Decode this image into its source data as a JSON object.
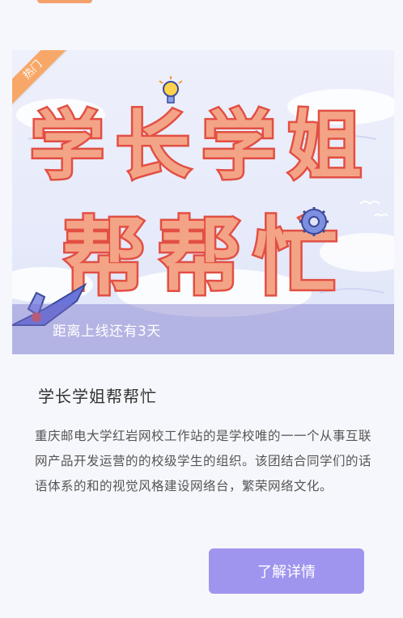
{
  "banner": {
    "hot_tag": "热门",
    "headline_line1": [
      "学",
      "长",
      "学",
      "姐"
    ],
    "headline_line2": [
      "帮",
      "帮",
      "忙"
    ],
    "countdown": "距离上线还有3天"
  },
  "item": {
    "title": "学长学姐帮帮忙",
    "description": "重庆邮电大学红岩网校工作站的是学校唯的一一个从事互联网产品开发运营的的校级学生的组织。该团结合同学们的话语体系的和的视觉风格建设网络台，繁荣网络文化。",
    "action_label": "了解详情"
  },
  "colors": {
    "accent": "#9f95ee",
    "hot_tag": "#f7a868",
    "title_fill": "#f39a77",
    "title_stroke": "#e84f45"
  }
}
